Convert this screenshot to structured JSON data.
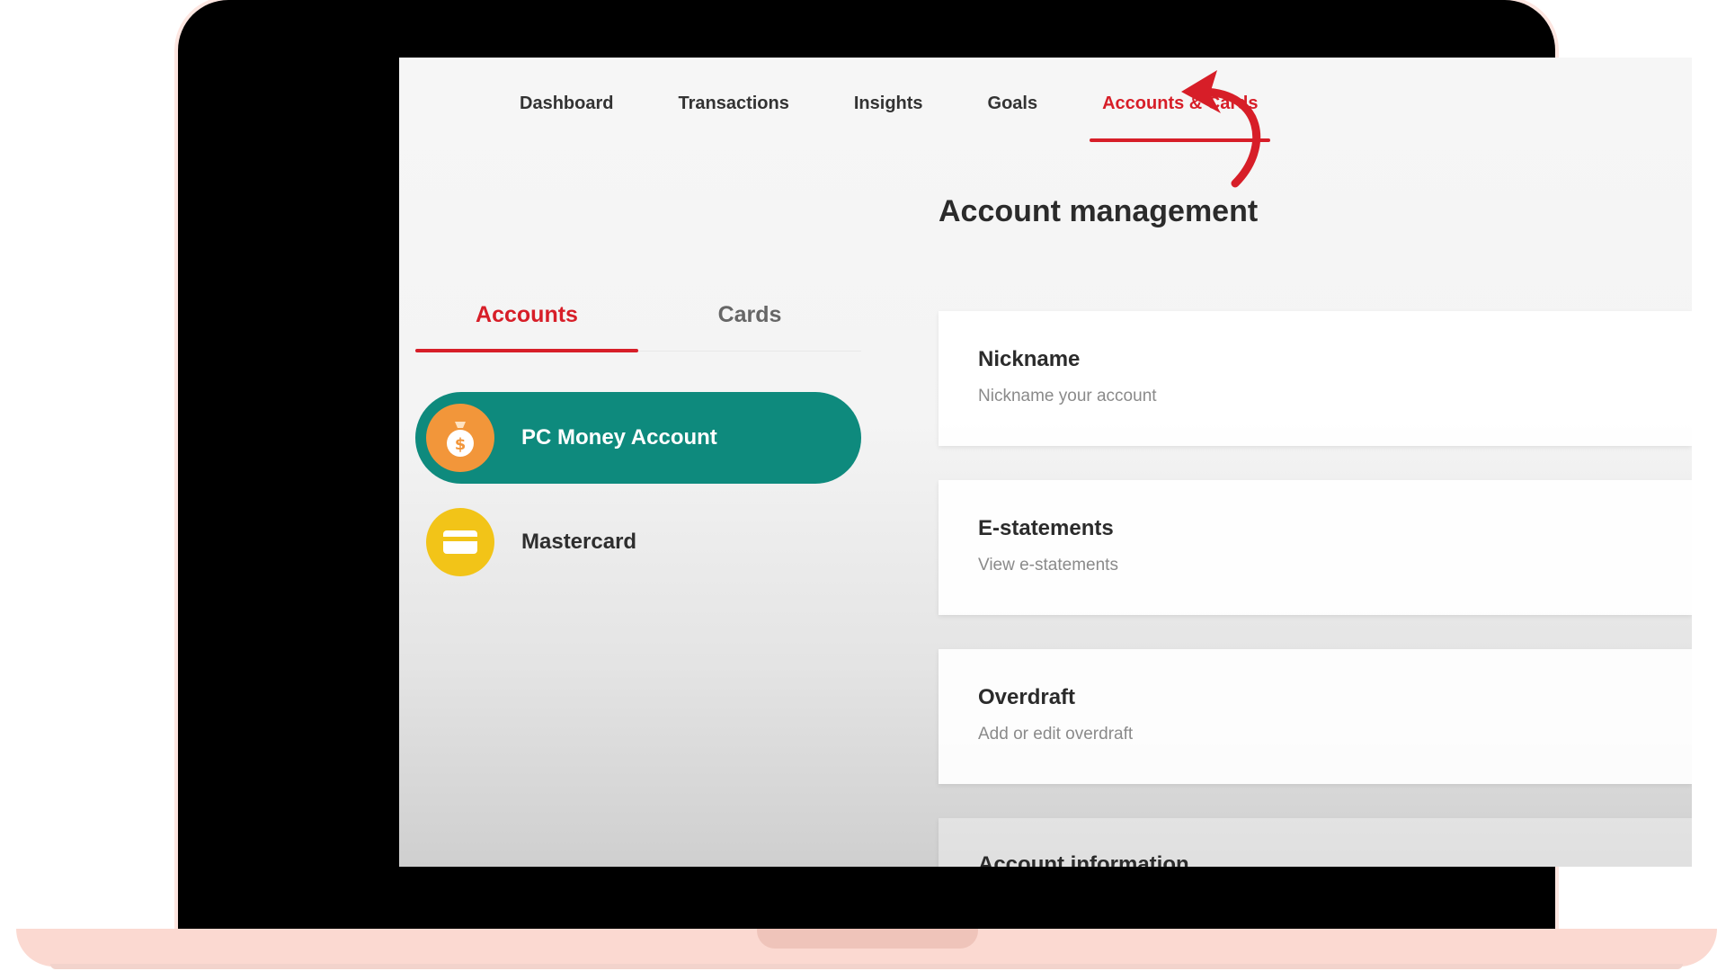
{
  "nav": {
    "items": [
      {
        "label": "Dashboard"
      },
      {
        "label": "Transactions"
      },
      {
        "label": "Insights"
      },
      {
        "label": "Goals"
      },
      {
        "label": "Accounts & Cards"
      }
    ],
    "active_index": 4
  },
  "page": {
    "title": "Account management"
  },
  "tabs": {
    "items": [
      {
        "label": "Accounts"
      },
      {
        "label": "Cards"
      }
    ],
    "active_index": 0
  },
  "accounts": [
    {
      "label": "PC Money Account",
      "icon": "money-bag-icon",
      "color": "#f2963a"
    },
    {
      "label": "Mastercard",
      "icon": "credit-card-icon",
      "color": "#f2c418"
    }
  ],
  "options": [
    {
      "title": "Nickname",
      "subtitle": "Nickname your account"
    },
    {
      "title": "E-statements",
      "subtitle": "View e-statements"
    },
    {
      "title": "Overdraft",
      "subtitle": "Add or edit overdraft"
    },
    {
      "title": "Account information"
    }
  ],
  "colors": {
    "accent_red": "#d71e28",
    "selected_teal": "#0e8a7d",
    "laptop_pink": "#fbd9d1"
  }
}
